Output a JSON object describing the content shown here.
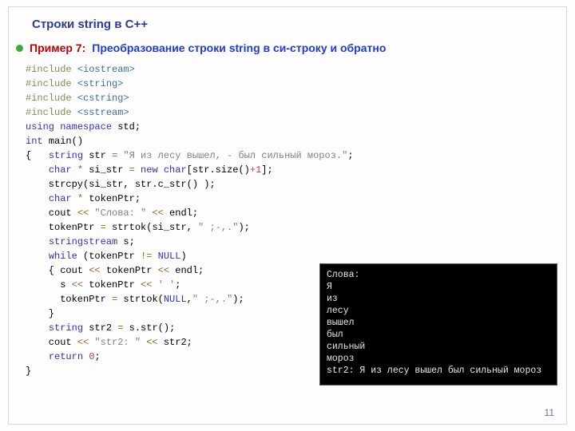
{
  "title": "Строки  string в С++",
  "example_label": "Пример 7:",
  "example_desc": "Преобразование строки string в си-строку и обратно",
  "code": {
    "l1": "#include <iostream>",
    "l2": "#include <string>",
    "l3": "#include <cstring>",
    "l4": "#include <sstream>",
    "l5": "using namespace std;",
    "l6": "int main()",
    "l7": "{   string str = \"Я из лесу вышел, - был сильный мороз.\";",
    "l8": "    char * si_str = new char[str.size()+1];",
    "l9": "    strcpy(si_str, str.c_str() );",
    "l10": "    char * tokenPtr;",
    "l11": "    cout << \"Слова: \" << endl;",
    "l12": "    tokenPtr = strtok(si_str, \" ;-,.\");",
    "l13": "    stringstream s;",
    "l14": "    while (tokenPtr != NULL)",
    "l15": "    { cout << tokenPtr << endl;",
    "l16": "      s << tokenPtr << ' ';",
    "l17": "      tokenPtr = strtok(NULL,\" ;-,.\");",
    "l18": "    }",
    "l19": "    string str2 = s.str();",
    "l20": "    cout << \"str2: \" << str2;",
    "l21": "    return 0;",
    "l22": "}"
  },
  "console_output": "Слова:\nЯ\nиз\nлесу\nвышел\nбыл\nсильный\nмороз\nstr2: Я из лесу вышел был сильный мороз",
  "page_number": "11"
}
